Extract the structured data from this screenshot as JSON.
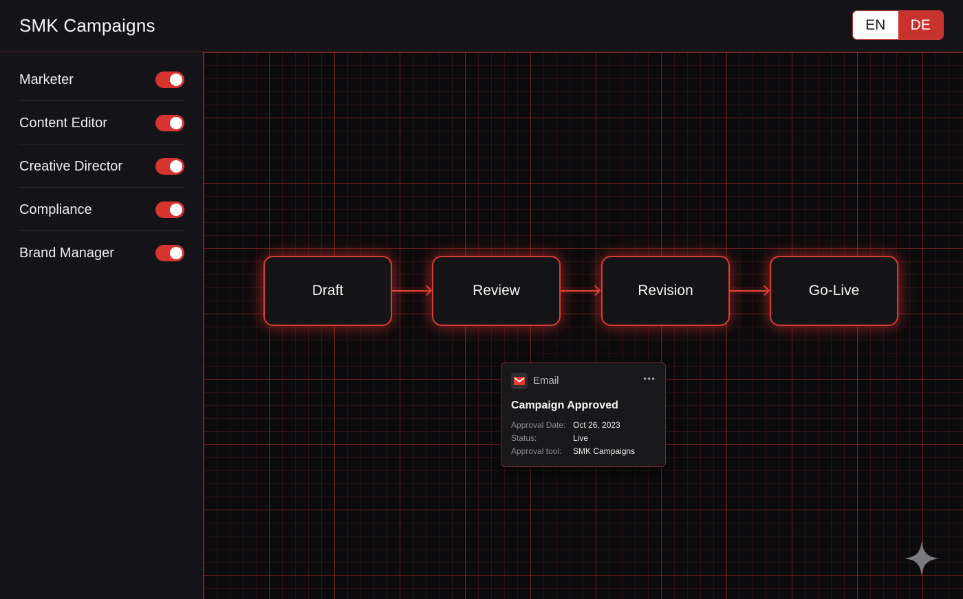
{
  "header": {
    "title": "SMK Campaigns",
    "languages": [
      {
        "label": "EN",
        "active": false
      },
      {
        "label": "DE",
        "active": true
      }
    ]
  },
  "sidebar": {
    "roles": [
      {
        "label": "Marketer",
        "enabled": true
      },
      {
        "label": "Content Editor",
        "enabled": true
      },
      {
        "label": "Creative Director",
        "enabled": true
      },
      {
        "label": "Compliance",
        "enabled": true
      },
      {
        "label": "Brand Manager",
        "enabled": true
      }
    ]
  },
  "workflow": {
    "stages": [
      "Draft",
      "Review",
      "Revision",
      "Go-Live"
    ]
  },
  "card": {
    "type": "Email",
    "icon": "mail-icon",
    "title": "Campaign Approved",
    "rows": [
      {
        "key": "Approval Date:",
        "value": "Oct 26, 2023"
      },
      {
        "key": "Status:",
        "value": "Live"
      },
      {
        "key": "Approval tool:",
        "value": "SMK Campaigns"
      }
    ]
  },
  "colors": {
    "accent": "#d8342f",
    "background": "#0e0e11",
    "panel": "#141418"
  }
}
